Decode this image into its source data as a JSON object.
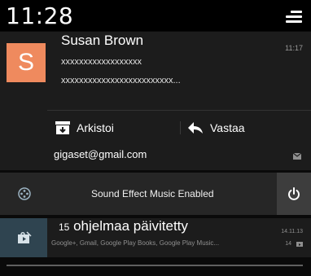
{
  "status_bar": {
    "time": "11:28",
    "quick_settings_icon": "quick-settings-icon"
  },
  "email_notification": {
    "avatar_letter": "S",
    "avatar_color": "#ef8a5e",
    "sender": "Susan Brown",
    "time": "11:17",
    "subject": "xxxxxxxxxxxxxxxxxx",
    "preview": "xxxxxxxxxxxxxxxxxxxxxxxxx...",
    "actions": [
      {
        "label": "Arkistoi",
        "icon": "archive-icon"
      },
      {
        "label": "Vastaa",
        "icon": "reply-icon"
      }
    ],
    "account": "gigaset@gmail.com",
    "account_icon": "mail-icon"
  },
  "sound_notification": {
    "icon": "sound-effect-icon",
    "text": "Sound Effect Music Enabled",
    "button_icon": "power-icon"
  },
  "update_notification": {
    "icon": "play-store-icon",
    "icon_bg": "#2f4450",
    "count": "15",
    "title": "ohjelmaa päivitetty",
    "subtitle": "Google+, Gmail, Google Play Books, Google Play Music...",
    "date": "14.11.13",
    "number": "14"
  }
}
